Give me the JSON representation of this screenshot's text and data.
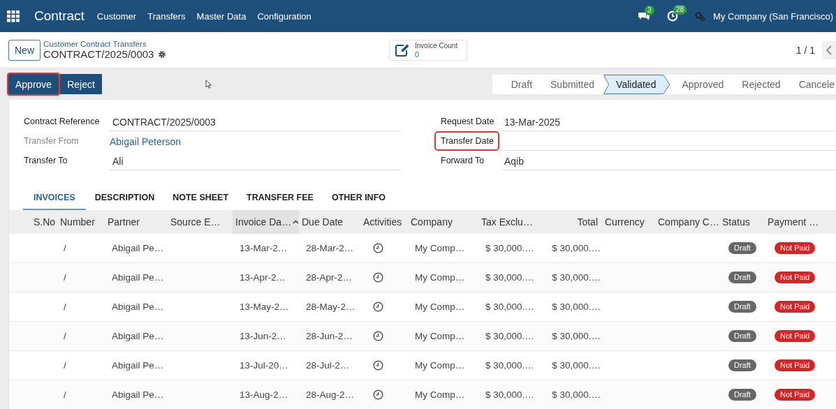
{
  "navbar": {
    "app_title": "Contract",
    "menu": [
      "Customer",
      "Transfers",
      "Master Data",
      "Configuration"
    ],
    "messages_count": "3",
    "activities_count": "28",
    "company": "My Company (San Francisco)"
  },
  "control_panel": {
    "new_button": "New",
    "breadcrumb": "Customer Contract Transfers",
    "record_title": "CONTRACT/2025/0003",
    "smart_button": {
      "label": "Invoice Count",
      "value": "0"
    },
    "pager": "1 / 1"
  },
  "action_buttons": [
    {
      "label": "Approve",
      "highlighted": true
    },
    {
      "label": "Reject",
      "highlighted": false
    }
  ],
  "stages": [
    {
      "label": "Draft",
      "selected": false
    },
    {
      "label": "Submitted",
      "selected": false
    },
    {
      "label": "Validated",
      "selected": true
    },
    {
      "label": "Approved",
      "selected": false
    },
    {
      "label": "Rejected",
      "selected": false
    },
    {
      "label": "Cancele",
      "selected": false
    }
  ],
  "fields_left": [
    {
      "label": "Contract Reference",
      "value": "CONTRACT/2025/0003",
      "kind": "text",
      "muted": false,
      "highlighted": false
    },
    {
      "label": "Transfer From",
      "value": "Abigail Peterson",
      "kind": "link",
      "muted": true,
      "highlighted": false
    },
    {
      "label": "Transfer To",
      "value": "Ali",
      "kind": "text",
      "muted": false,
      "highlighted": false
    }
  ],
  "fields_right": [
    {
      "label": "Request Date",
      "value": "13-Mar-2025",
      "kind": "text",
      "muted": false,
      "highlighted": false
    },
    {
      "label": "Transfer Date",
      "kind": "text",
      "muted": false,
      "highlighted": true
    },
    {
      "label": "Forward To",
      "value": "Aqib",
      "kind": "text",
      "muted": false,
      "highlighted": false
    }
  ],
  "tabs": [
    {
      "label": "INVOICES",
      "selected": true
    },
    {
      "label": "DESCRIPTION",
      "selected": false
    },
    {
      "label": "NOTE SHEET",
      "selected": false
    },
    {
      "label": "TRANSFER FEE",
      "selected": false
    },
    {
      "label": "OTHER INFO",
      "selected": false
    }
  ],
  "table": {
    "columns": [
      {
        "label": "S.No",
        "kind": "text",
        "sorted": false
      },
      {
        "label": "Number",
        "kind": "text",
        "sorted": false
      },
      {
        "label": "Partner",
        "kind": "text",
        "sorted": false
      },
      {
        "label": "Source E…",
        "kind": "text",
        "sorted": false
      },
      {
        "label": "Invoice Da…",
        "kind": "text",
        "sorted": true
      },
      {
        "label": "Due Date",
        "kind": "text",
        "sorted": false
      },
      {
        "label": "Activities",
        "kind": "text",
        "sorted": false
      },
      {
        "label": "Company",
        "kind": "text",
        "sorted": false
      },
      {
        "label": "Tax Exclu…",
        "kind": "text",
        "sorted": false
      },
      {
        "label": "Total",
        "kind": "amount",
        "sorted": false
      },
      {
        "label": "Currency",
        "kind": "text",
        "sorted": false
      },
      {
        "label": "Company C…",
        "kind": "text",
        "sorted": false
      },
      {
        "label": "Status",
        "kind": "text",
        "sorted": false
      },
      {
        "label": "Payment …",
        "kind": "text",
        "sorted": false
      }
    ],
    "rows": [
      {
        "number": "/",
        "partner": "Abigail Pe…",
        "invoice_date": "13-Mar-2…",
        "due_date": "28-Mar-2…",
        "company": "My Comp…",
        "tax_excluded": "$ 30,000.…",
        "total": "$ 30,000.…",
        "status": "Draft",
        "payment": "Not Paid"
      },
      {
        "number": "/",
        "partner": "Abigail Pe…",
        "invoice_date": "13-Apr-2…",
        "due_date": "28-Apr-2…",
        "company": "My Comp…",
        "tax_excluded": "$ 30,000.…",
        "total": "$ 30,000.…",
        "status": "Draft",
        "payment": "Not Paid"
      },
      {
        "number": "/",
        "partner": "Abigail Pe…",
        "invoice_date": "13-May-2…",
        "due_date": "28-May-2…",
        "company": "My Comp…",
        "tax_excluded": "$ 30,000.…",
        "total": "$ 30,000.…",
        "status": "Draft",
        "payment": "Not Paid"
      },
      {
        "number": "/",
        "partner": "Abigail Pe…",
        "invoice_date": "13-Jun-2…",
        "due_date": "28-Jun-2…",
        "company": "My Comp…",
        "tax_excluded": "$ 30,000.…",
        "total": "$ 30,000.…",
        "status": "Draft",
        "payment": "Not Paid"
      },
      {
        "number": "/",
        "partner": "Abigail Pe…",
        "invoice_date": "13-Jul-20…",
        "due_date": "28-Jul-2…",
        "company": "My Comp…",
        "tax_excluded": "$ 30,000.…",
        "total": "$ 30,000.…",
        "status": "Draft",
        "payment": "Not Paid"
      },
      {
        "number": "/",
        "partner": "Abigail Pe…",
        "invoice_date": "13-Aug-2…",
        "due_date": "28-Aug-2…",
        "company": "My Comp…",
        "tax_excluded": "$ 30,000.…",
        "total": "$ 30,000.…",
        "status": "Draft",
        "payment": "Not Paid"
      }
    ]
  }
}
